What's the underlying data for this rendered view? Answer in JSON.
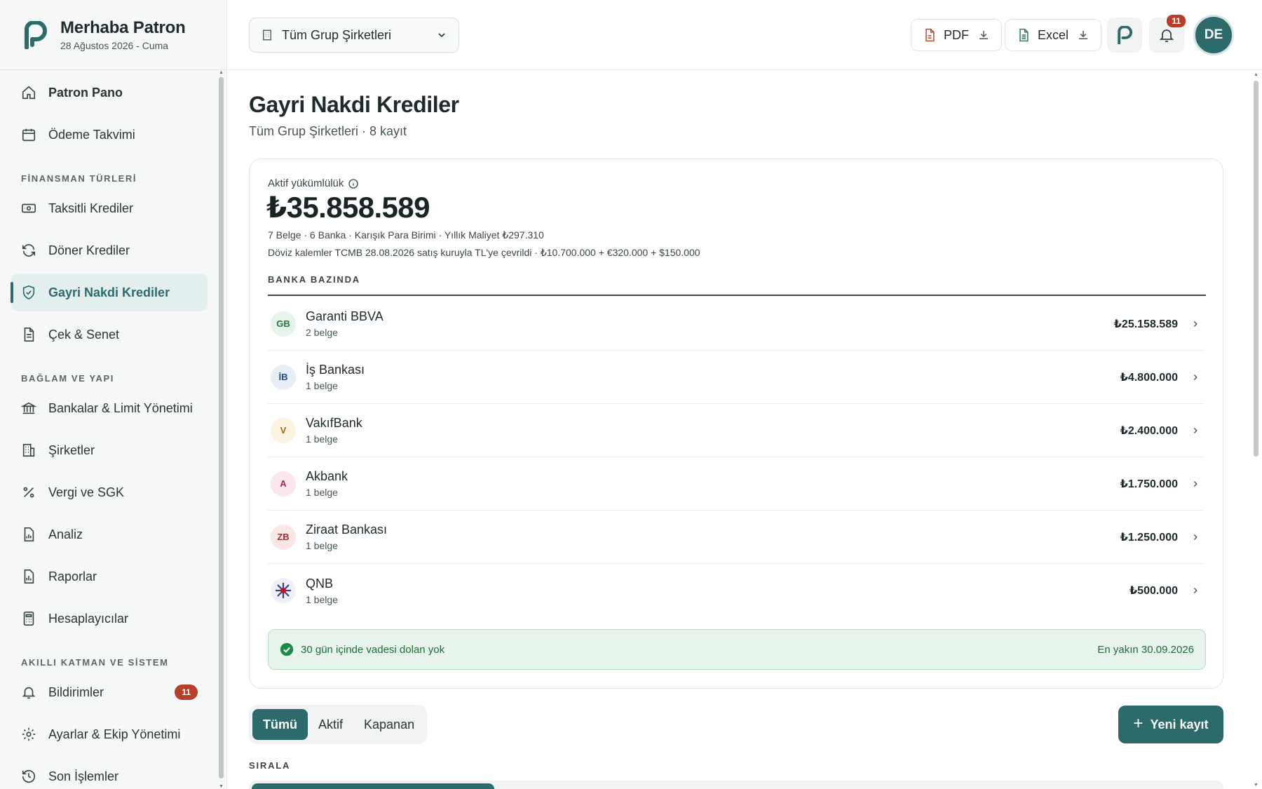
{
  "brand": {
    "title": "Merhaba Patron",
    "date": "28 Ağustos 2026 - Cuma"
  },
  "sidebar": {
    "items_top": [
      {
        "label": "Patron Pano",
        "icon": "home-icon"
      },
      {
        "label": "Ödeme Takvimi",
        "icon": "calendar-icon"
      }
    ],
    "section_finance": "FİNANSMAN TÜRLERİ",
    "items_finance": [
      {
        "label": "Taksitli Krediler",
        "icon": "banknote-icon"
      },
      {
        "label": "Döner Krediler",
        "icon": "refresh-icon"
      },
      {
        "label": "Gayri Nakdi Krediler",
        "icon": "shield-check-icon",
        "active": true
      },
      {
        "label": "Çek & Senet",
        "icon": "document-icon"
      }
    ],
    "section_context": "BAĞLAM VE YAPI",
    "items_context": [
      {
        "label": "Bankalar & Limit Yönetimi",
        "icon": "bank-icon"
      },
      {
        "label": "Şirketler",
        "icon": "building-icon"
      },
      {
        "label": "Vergi ve SGK",
        "icon": "percent-icon"
      },
      {
        "label": "Analiz",
        "icon": "chart-file-icon"
      },
      {
        "label": "Raporlar",
        "icon": "report-icon"
      },
      {
        "label": "Hesaplayıcılar",
        "icon": "calculator-icon"
      }
    ],
    "section_smart": "AKILLI KATMAN VE SİSTEM",
    "items_smart": [
      {
        "label": "Bildirimler",
        "icon": "bell-icon",
        "badge": "11"
      },
      {
        "label": "Ayarlar & Ekip Yönetimi",
        "icon": "gear-icon"
      },
      {
        "label": "Son İşlemler",
        "icon": "history-icon"
      }
    ]
  },
  "header": {
    "company_select": "Tüm Grup Şirketleri",
    "pdf_label": "PDF",
    "excel_label": "Excel",
    "notif_count": "11",
    "avatar_initials": "DE"
  },
  "page": {
    "title": "Gayri Nakdi Krediler",
    "subtitle": "Tüm Grup Şirketleri · 8 kayıt"
  },
  "summary": {
    "label": "Aktif yükümlülük",
    "amount": "₺35.858.589",
    "meta1": "7 Belge · 6 Banka · Karışık Para Birimi · Yıllık Maliyet ₺297.310",
    "meta2": "Döviz kalemler TCMB 28.08.2026 satış kuruyla TL'ye çevrildi · ₺10.700.000 + €320.000 + $150.000",
    "section": "BANKA BAZINDA"
  },
  "banks": [
    {
      "initials": "GB",
      "name": "Garanti BBVA",
      "count": "2 belge",
      "amount": "₺25.158.589",
      "bg": "#e6f3ea",
      "fg": "#1f7a3e"
    },
    {
      "initials": "İB",
      "name": "İş Bankası",
      "count": "1 belge",
      "amount": "₺4.800.000",
      "bg": "#e6edf5",
      "fg": "#1f4f86"
    },
    {
      "initials": "V",
      "name": "VakıfBank",
      "count": "1 belge",
      "amount": "₺2.400.000",
      "bg": "#fbf3df",
      "fg": "#9a6a0e"
    },
    {
      "initials": "A",
      "name": "Akbank",
      "count": "1 belge",
      "amount": "₺1.750.000",
      "bg": "#fbe5ee",
      "fg": "#b01f4f"
    },
    {
      "initials": "ZB",
      "name": "Ziraat Bankası",
      "count": "1 belge",
      "amount": "₺1.250.000",
      "bg": "#fbe6e6",
      "fg": "#b3262b"
    },
    {
      "initials": "",
      "name": "QNB",
      "count": "1 belge",
      "amount": "₺500.000",
      "bg": "#eef0f5",
      "fg": "#3a3f8f"
    }
  ],
  "banner": {
    "text": "30 gün içinde vadesi dolan yok",
    "nearest": "En yakın 30.09.2026"
  },
  "tabs": [
    "Tümü",
    "Aktif",
    "Kapanan"
  ],
  "new_button": "Yeni kayıt",
  "sort_label": "SIRALA",
  "colors": {
    "primary": "#2c6a6c",
    "danger": "#b8402b",
    "success": "#1f6b3a"
  }
}
